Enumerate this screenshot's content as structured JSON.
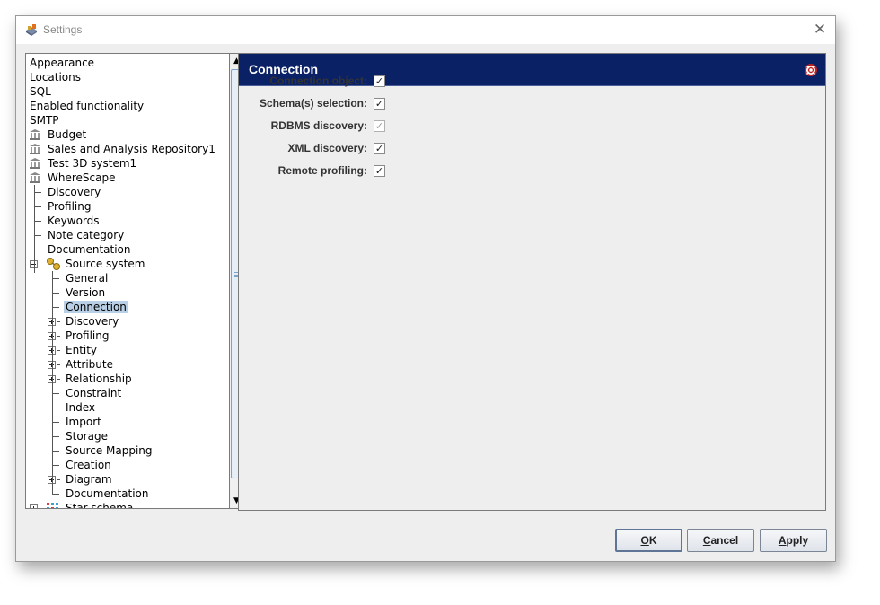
{
  "window": {
    "title": "Settings"
  },
  "tree": {
    "items": [
      {
        "label": "Appearance"
      },
      {
        "label": "Locations"
      },
      {
        "label": "SQL"
      },
      {
        "label": "Enabled functionality"
      },
      {
        "label": "SMTP"
      },
      {
        "label": "Budget",
        "icon": "bank-icon"
      },
      {
        "label": "Sales and Analysis Repository1",
        "icon": "bank-icon"
      },
      {
        "label": "Test 3D system1",
        "icon": "bank-icon"
      },
      {
        "label": "WhereScape",
        "icon": "bank-icon"
      },
      {
        "label": "Discovery"
      },
      {
        "label": "Profiling"
      },
      {
        "label": "Keywords"
      },
      {
        "label": "Note category"
      },
      {
        "label": "Documentation"
      },
      {
        "label": "Source system",
        "icon": "key-icon",
        "expanded": true
      },
      {
        "label": "General"
      },
      {
        "label": "Version"
      },
      {
        "label": "Connection",
        "selected": true
      },
      {
        "label": "Discovery",
        "expandable": true
      },
      {
        "label": "Profiling",
        "expandable": true
      },
      {
        "label": "Entity",
        "expandable": true
      },
      {
        "label": "Attribute",
        "expandable": true
      },
      {
        "label": "Relationship",
        "expandable": true
      },
      {
        "label": "Constraint"
      },
      {
        "label": "Index"
      },
      {
        "label": "Import"
      },
      {
        "label": "Storage"
      },
      {
        "label": "Source Mapping"
      },
      {
        "label": "Creation"
      },
      {
        "label": "Diagram",
        "expandable": true
      },
      {
        "label": "Documentation"
      },
      {
        "label": "Star schema",
        "icon": "star-schema-icon",
        "expandable": true
      }
    ]
  },
  "panel": {
    "title": "Connection",
    "fields": [
      {
        "label": "Connection object:",
        "checked": true,
        "enabled": true
      },
      {
        "label": "Schema(s) selection:",
        "checked": true,
        "enabled": true
      },
      {
        "label": "RDBMS discovery:",
        "checked": true,
        "enabled": false
      },
      {
        "label": "XML discovery:",
        "checked": true,
        "enabled": true
      },
      {
        "label": "Remote profiling:",
        "checked": true,
        "enabled": true
      }
    ]
  },
  "buttons": {
    "ok_mnemonic": "O",
    "ok_rest": "K",
    "cancel_mnemonic": "C",
    "cancel_rest": "ancel",
    "apply_mnemonic": "A",
    "apply_rest": "pply"
  },
  "colors": {
    "header_bg": "#0a2166",
    "selection": "#b8cfe5",
    "dialog_bg": "#eeeeee"
  }
}
